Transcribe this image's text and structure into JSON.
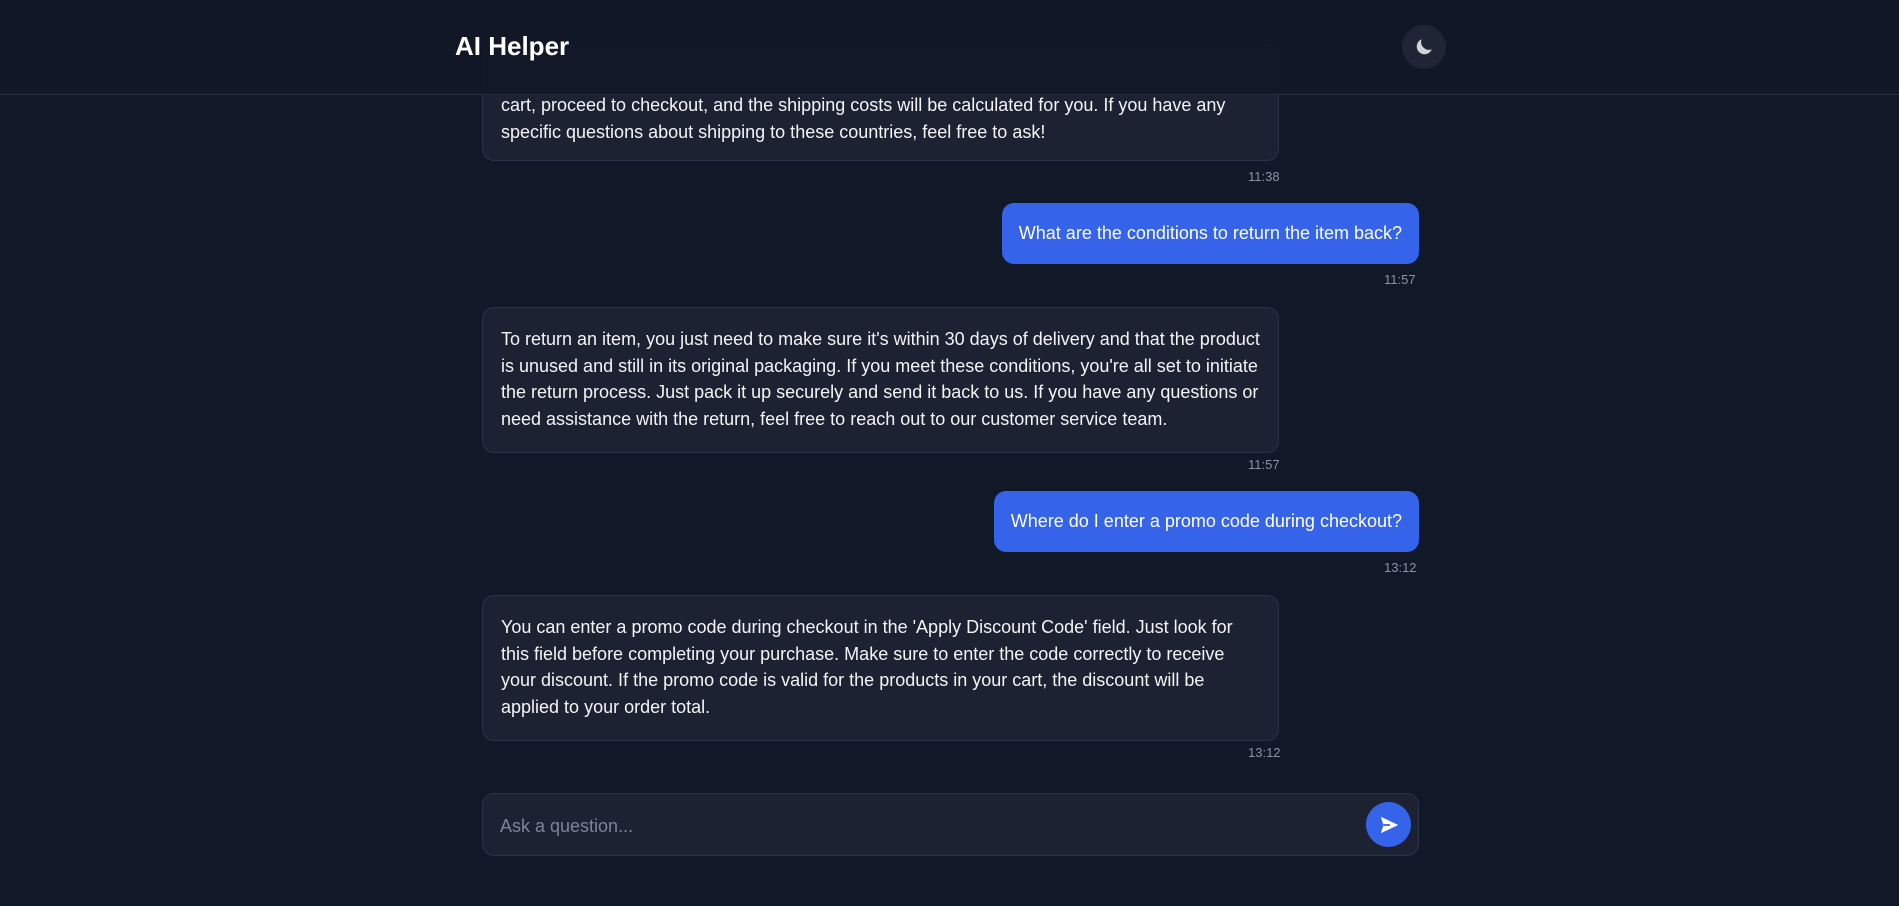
{
  "header": {
    "title": "AI Helper",
    "theme_icon": "moon-icon"
  },
  "messages": [
    {
      "role": "assistant",
      "text": "cart, proceed to checkout, and the shipping costs will be calculated for you. If you have any specific questions about shipping to these countries, feel free to ask!",
      "time": "11:38"
    },
    {
      "role": "user",
      "text": "What are the conditions to return the item back?",
      "time": "11:57"
    },
    {
      "role": "assistant",
      "text": "To return an item, you just need to make sure it's within 30 days of delivery and that the product is unused and still in its original packaging. If you meet these conditions, you're all set to initiate the return process. Just pack it up securely and send it back to us. If you have any questions or need assistance with the return, feel free to reach out to our customer service team.",
      "time": "11:57"
    },
    {
      "role": "user",
      "text": "Where do I enter a promo code during checkout?",
      "time": "13:12"
    },
    {
      "role": "assistant",
      "text": "You can enter a promo code during checkout in the 'Apply Discount Code' field. Just look for this field before completing your purchase. Make sure to enter the code correctly to receive your discount. If the promo code is valid for the products in your cart, the discount will be applied to your order total.",
      "time": "13:12"
    }
  ],
  "composer": {
    "placeholder": "Ask a question...",
    "value": "",
    "send_icon": "send-icon"
  },
  "colors": {
    "background": "#111827",
    "accent": "#3563e9",
    "bubble": "#1c2232"
  }
}
